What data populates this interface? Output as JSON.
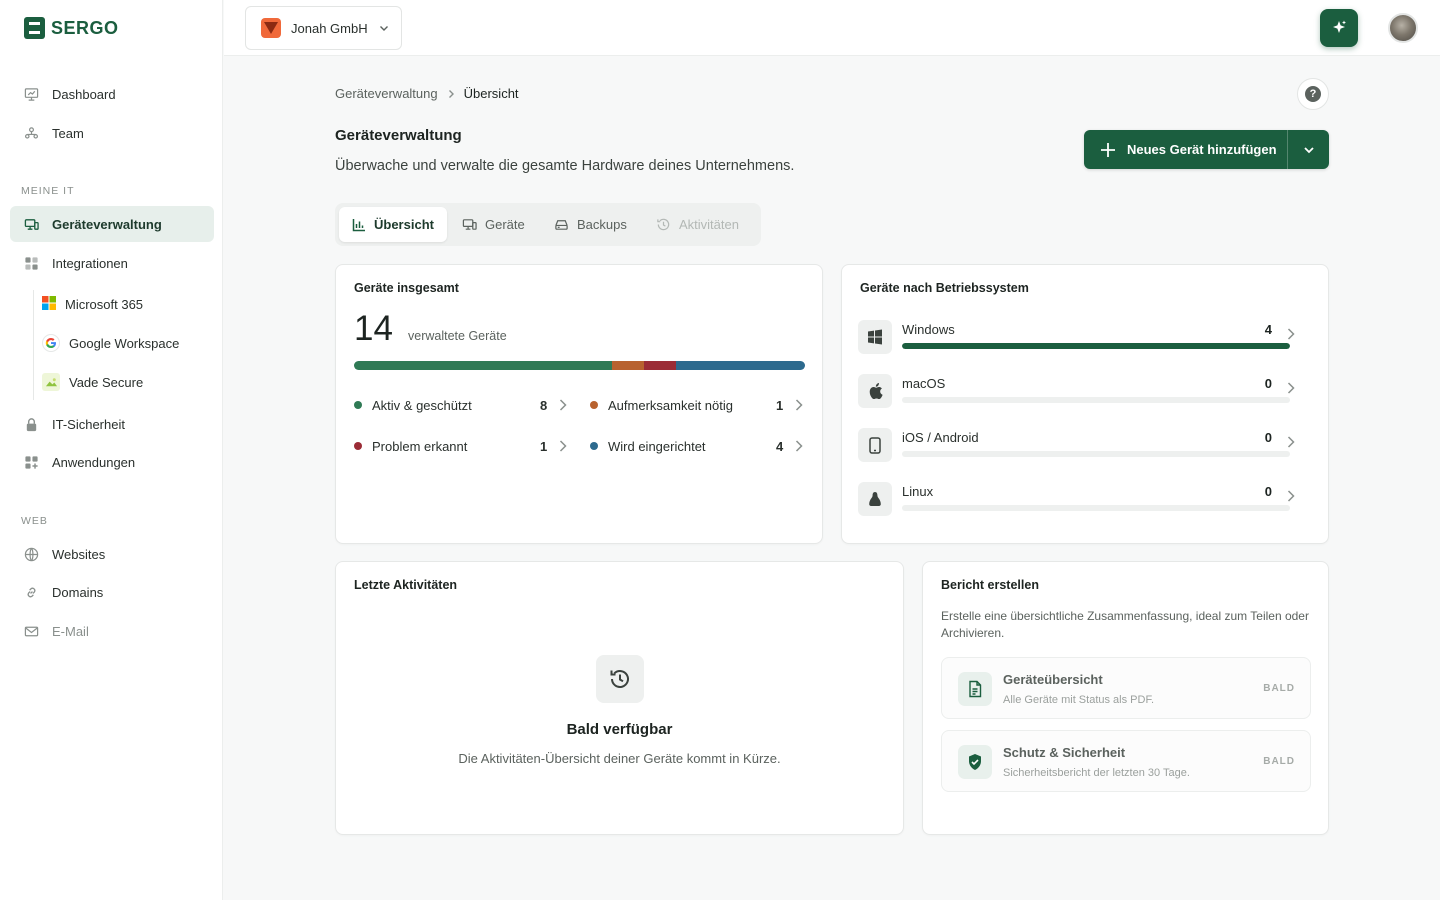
{
  "brand": {
    "name": "SERGO",
    "color": "#1b5e3f"
  },
  "sidebar": {
    "items": [
      {
        "label": "Dashboard",
        "icon": "monitor-chart-icon"
      },
      {
        "label": "Team",
        "icon": "team-icon"
      }
    ],
    "section_meine_it": "MEINE IT",
    "meine_it_items": [
      {
        "label": "Geräteverwaltung",
        "icon": "devices-icon",
        "active": true
      },
      {
        "label": "Integrationen",
        "icon": "integrations-icon"
      }
    ],
    "integrations": [
      {
        "label": "Microsoft 365",
        "icon": "microsoft-icon"
      },
      {
        "label": "Google Workspace",
        "icon": "google-icon"
      },
      {
        "label": "Vade Secure",
        "icon": "vade-icon"
      }
    ],
    "more_items": [
      {
        "label": "IT-Sicherheit",
        "icon": "lock-icon"
      },
      {
        "label": "Anwendungen",
        "icon": "apps-grid-icon"
      }
    ],
    "section_web": "WEB",
    "web_items": [
      {
        "label": "Websites",
        "icon": "globe-icon"
      },
      {
        "label": "Domains",
        "icon": "link-icon"
      },
      {
        "label": "E-Mail",
        "icon": "mail-icon"
      }
    ]
  },
  "topbar": {
    "org_name": "Jonah GmbH"
  },
  "breadcrumb": {
    "parent": "Geräteverwaltung",
    "current": "Übersicht"
  },
  "header": {
    "title": "Geräteverwaltung",
    "subtitle": "Überwache und verwalte die gesamte Hardware deines Unternehmens.",
    "primary_button": "Neues Gerät hinzufügen"
  },
  "tabs": [
    {
      "label": "Übersicht",
      "icon": "bar-chart-icon",
      "state": "active"
    },
    {
      "label": "Geräte",
      "icon": "devices-icon",
      "state": "normal"
    },
    {
      "label": "Backups",
      "icon": "backup-drive-icon",
      "state": "normal"
    },
    {
      "label": "Aktivitäten",
      "icon": "history-icon",
      "state": "disabled"
    }
  ],
  "total_card": {
    "title": "Geräte insgesamt",
    "total": "14",
    "total_label": "verwaltete Geräte",
    "segments": [
      {
        "value": 8,
        "color": "#2f7a55"
      },
      {
        "value": 1,
        "color": "#b8622f"
      },
      {
        "value": 1,
        "color": "#9b2c36"
      },
      {
        "value": 4,
        "color": "#2d6a8e"
      }
    ],
    "stats": [
      {
        "label": "Aktiv & geschützt",
        "value": "8",
        "color": "#2f7a55"
      },
      {
        "label": "Aufmerksamkeit nötig",
        "value": "1",
        "color": "#b8622f"
      },
      {
        "label": "Problem erkannt",
        "value": "1",
        "color": "#9b2c36"
      },
      {
        "label": "Wird eingerichtet",
        "value": "4",
        "color": "#2d6a8e"
      }
    ]
  },
  "os_card": {
    "title": "Geräte nach Betriebssystem",
    "rows": [
      {
        "name": "Windows",
        "value": "4",
        "fraction": 1.0,
        "icon": "windows-icon"
      },
      {
        "name": "macOS",
        "value": "0",
        "fraction": 0,
        "icon": "apple-icon"
      },
      {
        "name": "iOS / Android",
        "value": "0",
        "fraction": 0,
        "icon": "smartphone-icon"
      },
      {
        "name": "Linux",
        "value": "0",
        "fraction": 0,
        "icon": "linux-icon"
      }
    ]
  },
  "activity_card": {
    "title": "Letzte Aktivitäten",
    "empty_title": "Bald verfügbar",
    "empty_text": "Die Aktivitäten-Übersicht deiner Geräte kommt in Kürze."
  },
  "report_card": {
    "title": "Bericht erstellen",
    "description": "Erstelle eine übersichtliche Zusammenfassung, ideal zum Teilen oder Archivieren.",
    "items": [
      {
        "title": "Geräteübersicht",
        "subtitle": "Alle Geräte mit Status als PDF.",
        "badge": "BALD",
        "icon": "document-icon"
      },
      {
        "title": "Schutz & Sicherheit",
        "subtitle": "Sicherheitsbericht der letzten 30 Tage.",
        "badge": "BALD",
        "icon": "shield-check-icon"
      }
    ]
  }
}
